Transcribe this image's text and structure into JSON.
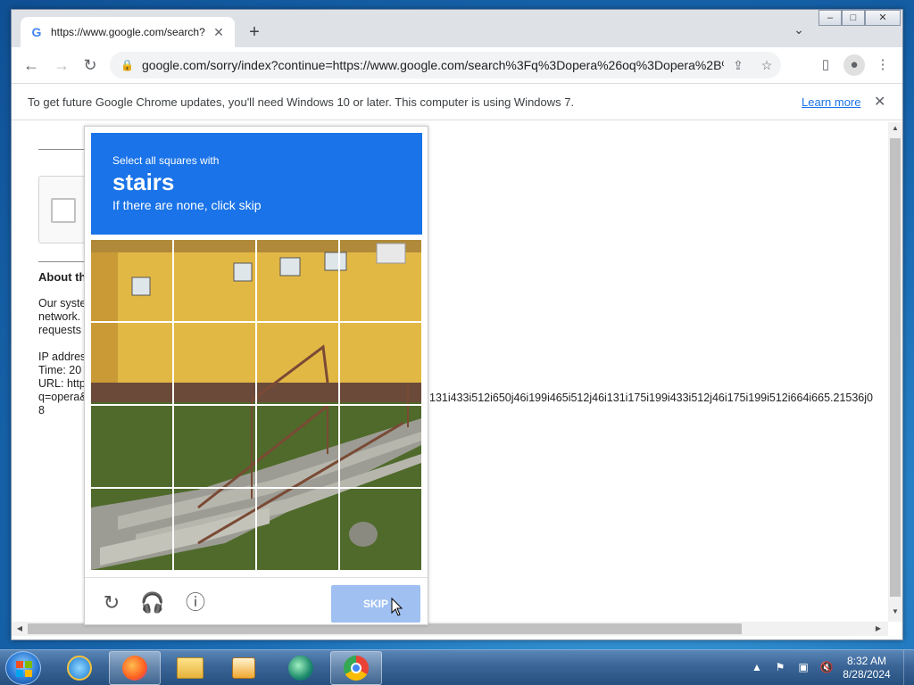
{
  "browser": {
    "tab_title": "https://www.google.com/search?",
    "favicon": "G",
    "url": "google.com/sorry/index?continue=https://www.google.com/search%3Fq%3Dopera%26oq%3Dopera%2B%...",
    "window_controls": [
      "minimize",
      "maximize",
      "close"
    ]
  },
  "infobar": {
    "message": "To get future Google Chrome updates, you'll need Windows 10 or later. This computer is using Windows 7.",
    "learn_more": "Learn more"
  },
  "page": {
    "about_heading": "About th",
    "para1_lines": "Our syste\nnetwork.\nrequests",
    "para2_lines": "IP addres\nTime: 20\nURL: http\nq=opera&\n8",
    "url_tail": "131i433i512i650j46i199i465i512j46i131i175i199i433i512j46i175i199i512i664i665.21536j0"
  },
  "captcha": {
    "instruction_line1": "Select all squares with",
    "target_word": "stairs",
    "instruction_line3": "If there are none, click skip",
    "skip_label": "SKIP",
    "grid_rows": 4,
    "grid_cols": 4
  },
  "taskbar": {
    "apps": [
      "internet-explorer",
      "firefox",
      "file-explorer",
      "media-player",
      "edge-beta",
      "chrome"
    ],
    "time": "8:32 AM",
    "date": "8/28/2024"
  },
  "colors": {
    "captcha_header": "#1a73e8",
    "skip_button": "#9fc0f0",
    "link": "#1a73e8"
  }
}
